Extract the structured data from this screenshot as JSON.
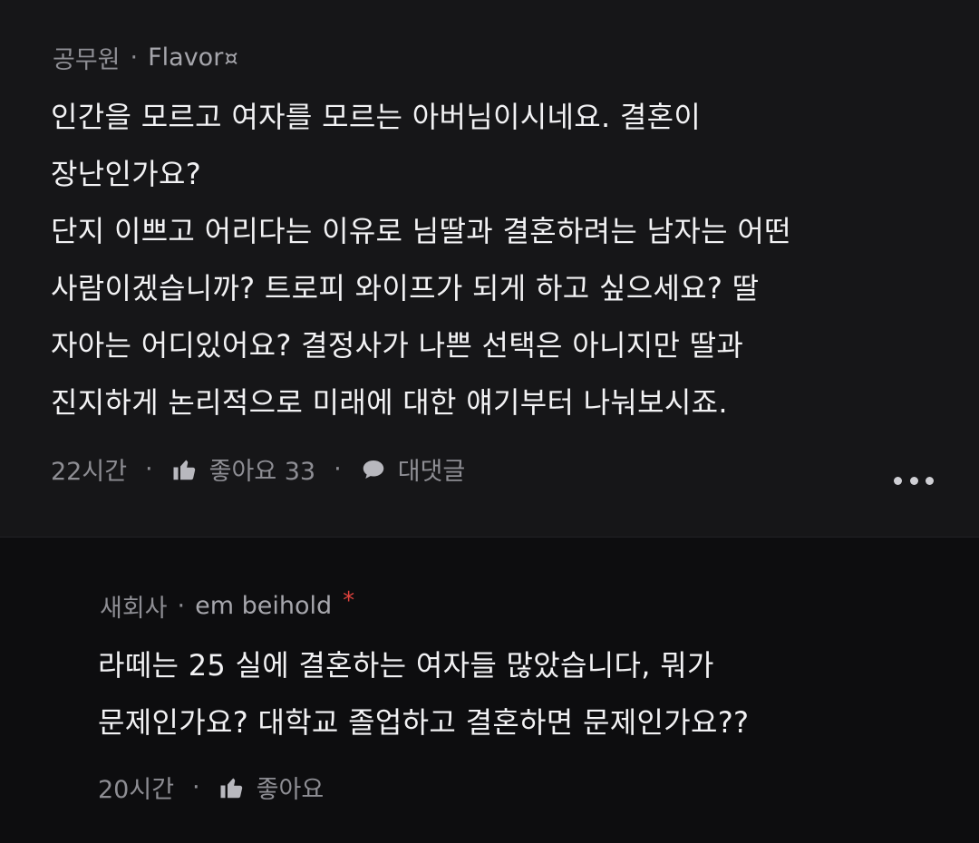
{
  "comment": {
    "company": "공무원",
    "nickname": "Flavor",
    "badge": "¤",
    "body_lines": [
      "인간을 모르고 여자를 모르는 아버님이시네요. 결혼이",
      "장난인가요?",
      "단지 이쁘고 어리다는 이유로 님딸과 결혼하려는 남자는 어떤",
      "사람이겠습니까? 트로피 와이프가 되게 하고 싶으세요? 딸",
      "자아는 어디있어요?  결정사가 나쁜 선택은 아니지만 딸과",
      "진지하게 논리적으로 미래에 대한 얘기부터 나눠보시죠."
    ],
    "time": "22시간",
    "like_label": "좋아요 33",
    "reply_label": "대댓글",
    "icons": [
      "thumbs-up-icon",
      "speech-bubble-icon",
      "more-icon"
    ]
  },
  "reply": {
    "company": "새회사",
    "nickname": "em beihold",
    "mark": "*",
    "body_lines": [
      "라떼는 25 실에 결혼하는 여자들 많았습니다, 뭐가",
      "문제인가요? 대학교 졸업하고 결혼하면 문제인가요??"
    ],
    "time": "20시간",
    "like_label": "좋아요",
    "icons": [
      "thumbs-up-icon"
    ]
  },
  "separator": "·"
}
